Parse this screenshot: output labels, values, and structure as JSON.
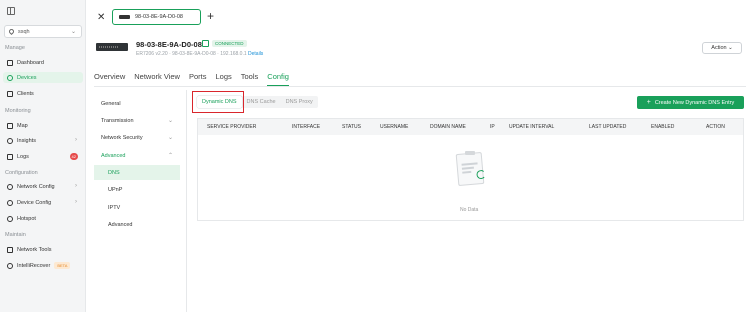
{
  "sidebar": {
    "site": "ssqh",
    "sections": {
      "manage": "Manage",
      "monitoring": "Monitoring",
      "configuration": "Configuration",
      "maintain": "Maintain"
    },
    "items": {
      "dashboard": "Dashboard",
      "devices": "Devices",
      "clients": "Clients",
      "map": "Map",
      "insights": "Insights",
      "logs": "Logs",
      "logs_badge": "42",
      "network_config": "Network Config",
      "device_config": "Device Config",
      "hotspot": "Hotspot",
      "network_tools": "Network Tools",
      "intelli_recover": "IntelliRecover",
      "beta": "BETA"
    }
  },
  "header": {
    "tab_label": "98-03-8E-9A-D0-08",
    "device_name": "98-03-8E-9A-D0-08",
    "status": "CONNECTED",
    "meta": "ER7206 v2.20 · 98-03-8E-9A-D0-08 · 192.168.0.1",
    "details": "Details",
    "action": "Action"
  },
  "tabs": [
    "Overview",
    "Network View",
    "Ports",
    "Logs",
    "Tools",
    "Config"
  ],
  "config_nav": {
    "general": "General",
    "transmission": "Transmission",
    "network_security": "Network Security",
    "advanced_group": "Advanced",
    "dns": "DNS",
    "upnp": "UPnP",
    "iptv": "IPTV",
    "advanced": "Advanced"
  },
  "subtabs": [
    "Dynamic DNS",
    "DNS Cache",
    "DNS Proxy"
  ],
  "create_button": "Create New Dynamic DNS Entry",
  "table": {
    "headers": [
      "SERVICE PROVIDER",
      "INTERFACE",
      "STATUS",
      "USERNAME",
      "DOMAIN NAME",
      "IP",
      "UPDATE INTERVAL",
      "LAST UPDATED",
      "ENABLED",
      "ACTION"
    ],
    "empty": "No Data"
  },
  "colors": {
    "accent": "#19a05a",
    "highlight": "#d9262c"
  }
}
